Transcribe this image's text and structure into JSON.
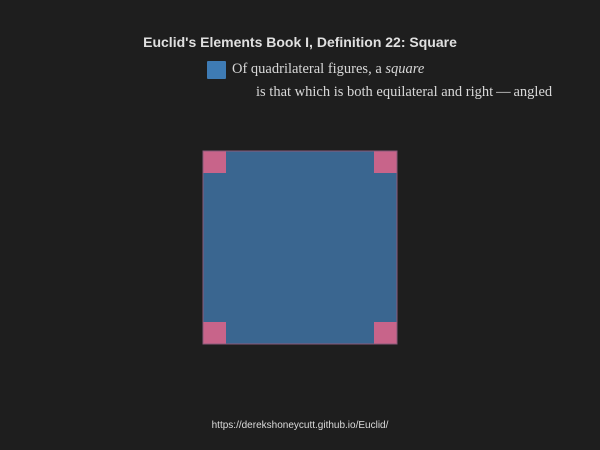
{
  "title": "Euclid's Elements Book I, Definition 22: Square",
  "legend": {
    "line1_before": "Of quadrilateral figures, a ",
    "line1_term": "square",
    "line2": "is that which is both equilateral and right — angled",
    "swatch_color": "#3e7bb4"
  },
  "figure": {
    "shape": "square",
    "fill_color": "#3a6690",
    "edge_color": "#8a5a7a",
    "right_angle_marker_color": "#c8648a",
    "right_angle_markers": [
      "top-left",
      "top-right",
      "bottom-right",
      "bottom-left"
    ]
  },
  "source_url": "https://derekshoneycutt.github.io/Euclid/"
}
